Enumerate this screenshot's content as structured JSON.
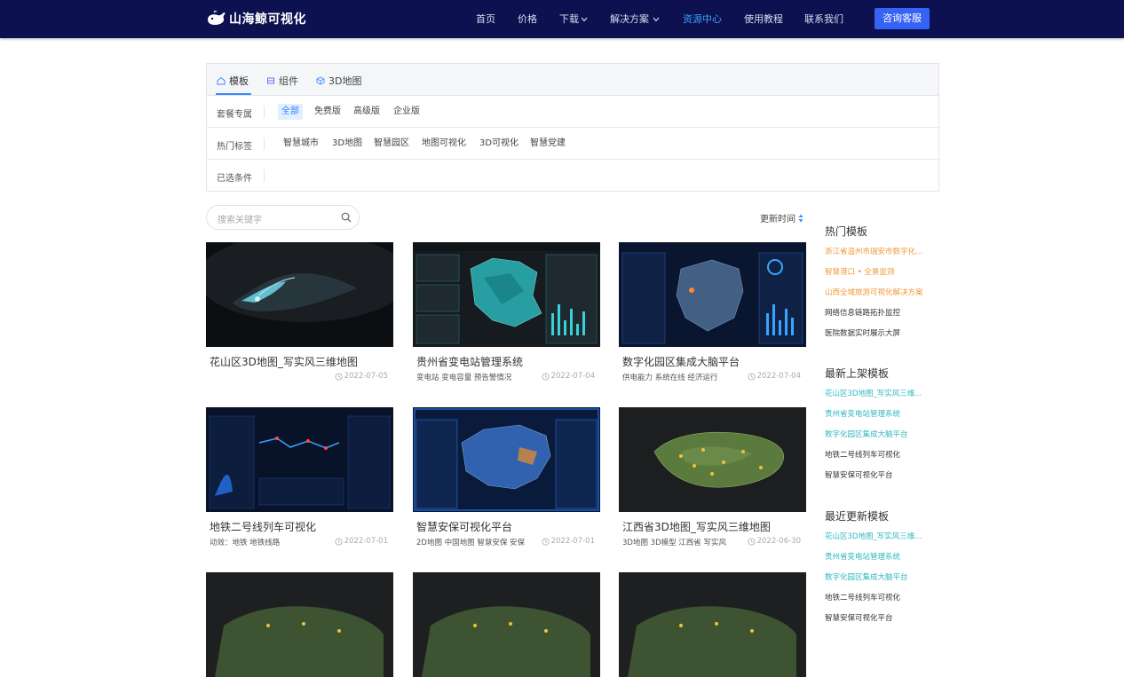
{
  "brand": {
    "name": "山海鲸可视化"
  },
  "nav": {
    "items": [
      {
        "label": "首页",
        "active": false
      },
      {
        "label": "价格",
        "active": false
      },
      {
        "label": "下载",
        "active": false,
        "dropdown": true
      },
      {
        "label": "解决方案",
        "active": false,
        "dropdown": true
      },
      {
        "label": "资源中心",
        "active": true
      },
      {
        "label": "使用教程",
        "active": false
      },
      {
        "label": "联系我们",
        "active": false
      }
    ],
    "cta": "咨询客服"
  },
  "filters": {
    "tabs": [
      {
        "label": "模板",
        "icon": "home-icon",
        "active": true
      },
      {
        "label": "组件",
        "icon": "component-icon",
        "active": false
      },
      {
        "label": "3D地图",
        "icon": "cube-icon",
        "active": false
      }
    ],
    "rows": [
      {
        "label": "套餐专属",
        "options": [
          "全部",
          "免费版",
          "高级版",
          "企业版"
        ],
        "selected": "全部"
      },
      {
        "label": "热门标签",
        "options": [
          "智慧城市",
          "3D地图",
          "智慧园区",
          "地图可视化",
          "3D可视化",
          "智慧党建"
        ],
        "selected": ""
      },
      {
        "label": "已选条件",
        "options": [],
        "selected": ""
      }
    ]
  },
  "search": {
    "placeholder": "搜索关键字"
  },
  "sort": {
    "label": "更新时间"
  },
  "cards": [
    {
      "title": "花山区3D地图_写实风三维地图",
      "tags": "",
      "date": "2022-07-05",
      "theme": "map3d"
    },
    {
      "title": "贵州省变电站管理系统",
      "tags": "变电站 变电容量 预告警情况",
      "date": "2022-07-04",
      "theme": "teal-dash"
    },
    {
      "title": "数字化园区集成大脑平台",
      "tags": "供电能力 系统在线 经济运行",
      "date": "2022-07-04",
      "theme": "blue-dash"
    },
    {
      "title": "地铁二号线列车可视化",
      "tags": "动效：地铁 地铁线路",
      "date": "2022-07-01",
      "theme": "metro"
    },
    {
      "title": "智慧安保可视化平台",
      "tags": "2D地图 中国地图 智慧安保 安保",
      "date": "2022-07-01",
      "theme": "china"
    },
    {
      "title": "江西省3D地图_写实风三维地图",
      "tags": "3D地图 3D模型 江西省 写实风",
      "date": "2022-06-30",
      "theme": "greenmap"
    },
    {
      "title": "",
      "tags": "",
      "date": "",
      "theme": "greenmap2"
    },
    {
      "title": "",
      "tags": "",
      "date": "",
      "theme": "greenmap2"
    },
    {
      "title": "",
      "tags": "",
      "date": "",
      "theme": "greenmap2"
    }
  ],
  "sidebar": {
    "sections": [
      {
        "heading": "热门模板",
        "links": [
          {
            "text": "浙江省温州市瑞安市数字化...",
            "color": "#f0983a"
          },
          {
            "text": "智慧港口 • 全景监测",
            "color": "#f0983a"
          },
          {
            "text": "山西全域旅游可视化解决方案",
            "color": "#f0983a"
          },
          {
            "text": "网络信息链路拓扑监控",
            "color": "#333333"
          },
          {
            "text": "医院数据实时展示大屏",
            "color": "#333333"
          }
        ]
      },
      {
        "heading": "最新上架模板",
        "links": [
          {
            "text": "花山区3D地图_写实风三维...",
            "color": "#2fb8c0"
          },
          {
            "text": "贵州省变电站管理系统",
            "color": "#2fb8c0"
          },
          {
            "text": "数字化园区集成大脑平台",
            "color": "#2fb8c0"
          },
          {
            "text": "地铁二号线列车可视化",
            "color": "#333333"
          },
          {
            "text": "智慧安保可视化平台",
            "color": "#333333"
          }
        ]
      },
      {
        "heading": "最近更新模板",
        "links": [
          {
            "text": "花山区3D地图_写实风三维...",
            "color": "#2fb8c0"
          },
          {
            "text": "贵州省变电站管理系统",
            "color": "#2fb8c0"
          },
          {
            "text": "数字化园区集成大脑平台",
            "color": "#2fb8c0"
          },
          {
            "text": "地铁二号线列车可视化",
            "color": "#333333"
          },
          {
            "text": "智慧安保可视化平台",
            "color": "#333333"
          }
        ]
      }
    ]
  }
}
